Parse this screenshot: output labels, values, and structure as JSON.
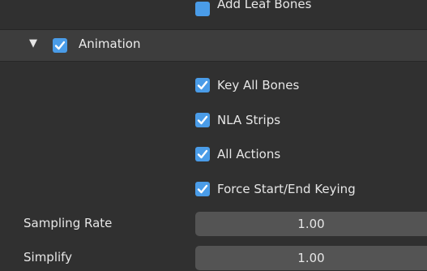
{
  "top_partial": {
    "label": "Add Leaf Bones"
  },
  "animation_panel": {
    "title": "Animation",
    "checked": true,
    "options": [
      {
        "label": "Key All Bones",
        "checked": true
      },
      {
        "label": "NLA Strips",
        "checked": true
      },
      {
        "label": "All Actions",
        "checked": true
      },
      {
        "label": "Force Start/End Keying",
        "checked": true
      }
    ],
    "sampling_rate": {
      "label": "Sampling Rate",
      "value": "1.00"
    },
    "simplify": {
      "label": "Simplify",
      "value": "1.00"
    }
  },
  "colors": {
    "accent": "#4a9ce8",
    "panel_bg": "#303030",
    "header_bg": "#3d3d3d",
    "field_bg": "#545454"
  },
  "icons": {
    "disclosure": "triangle-down-icon",
    "check": "checkmark-icon"
  }
}
